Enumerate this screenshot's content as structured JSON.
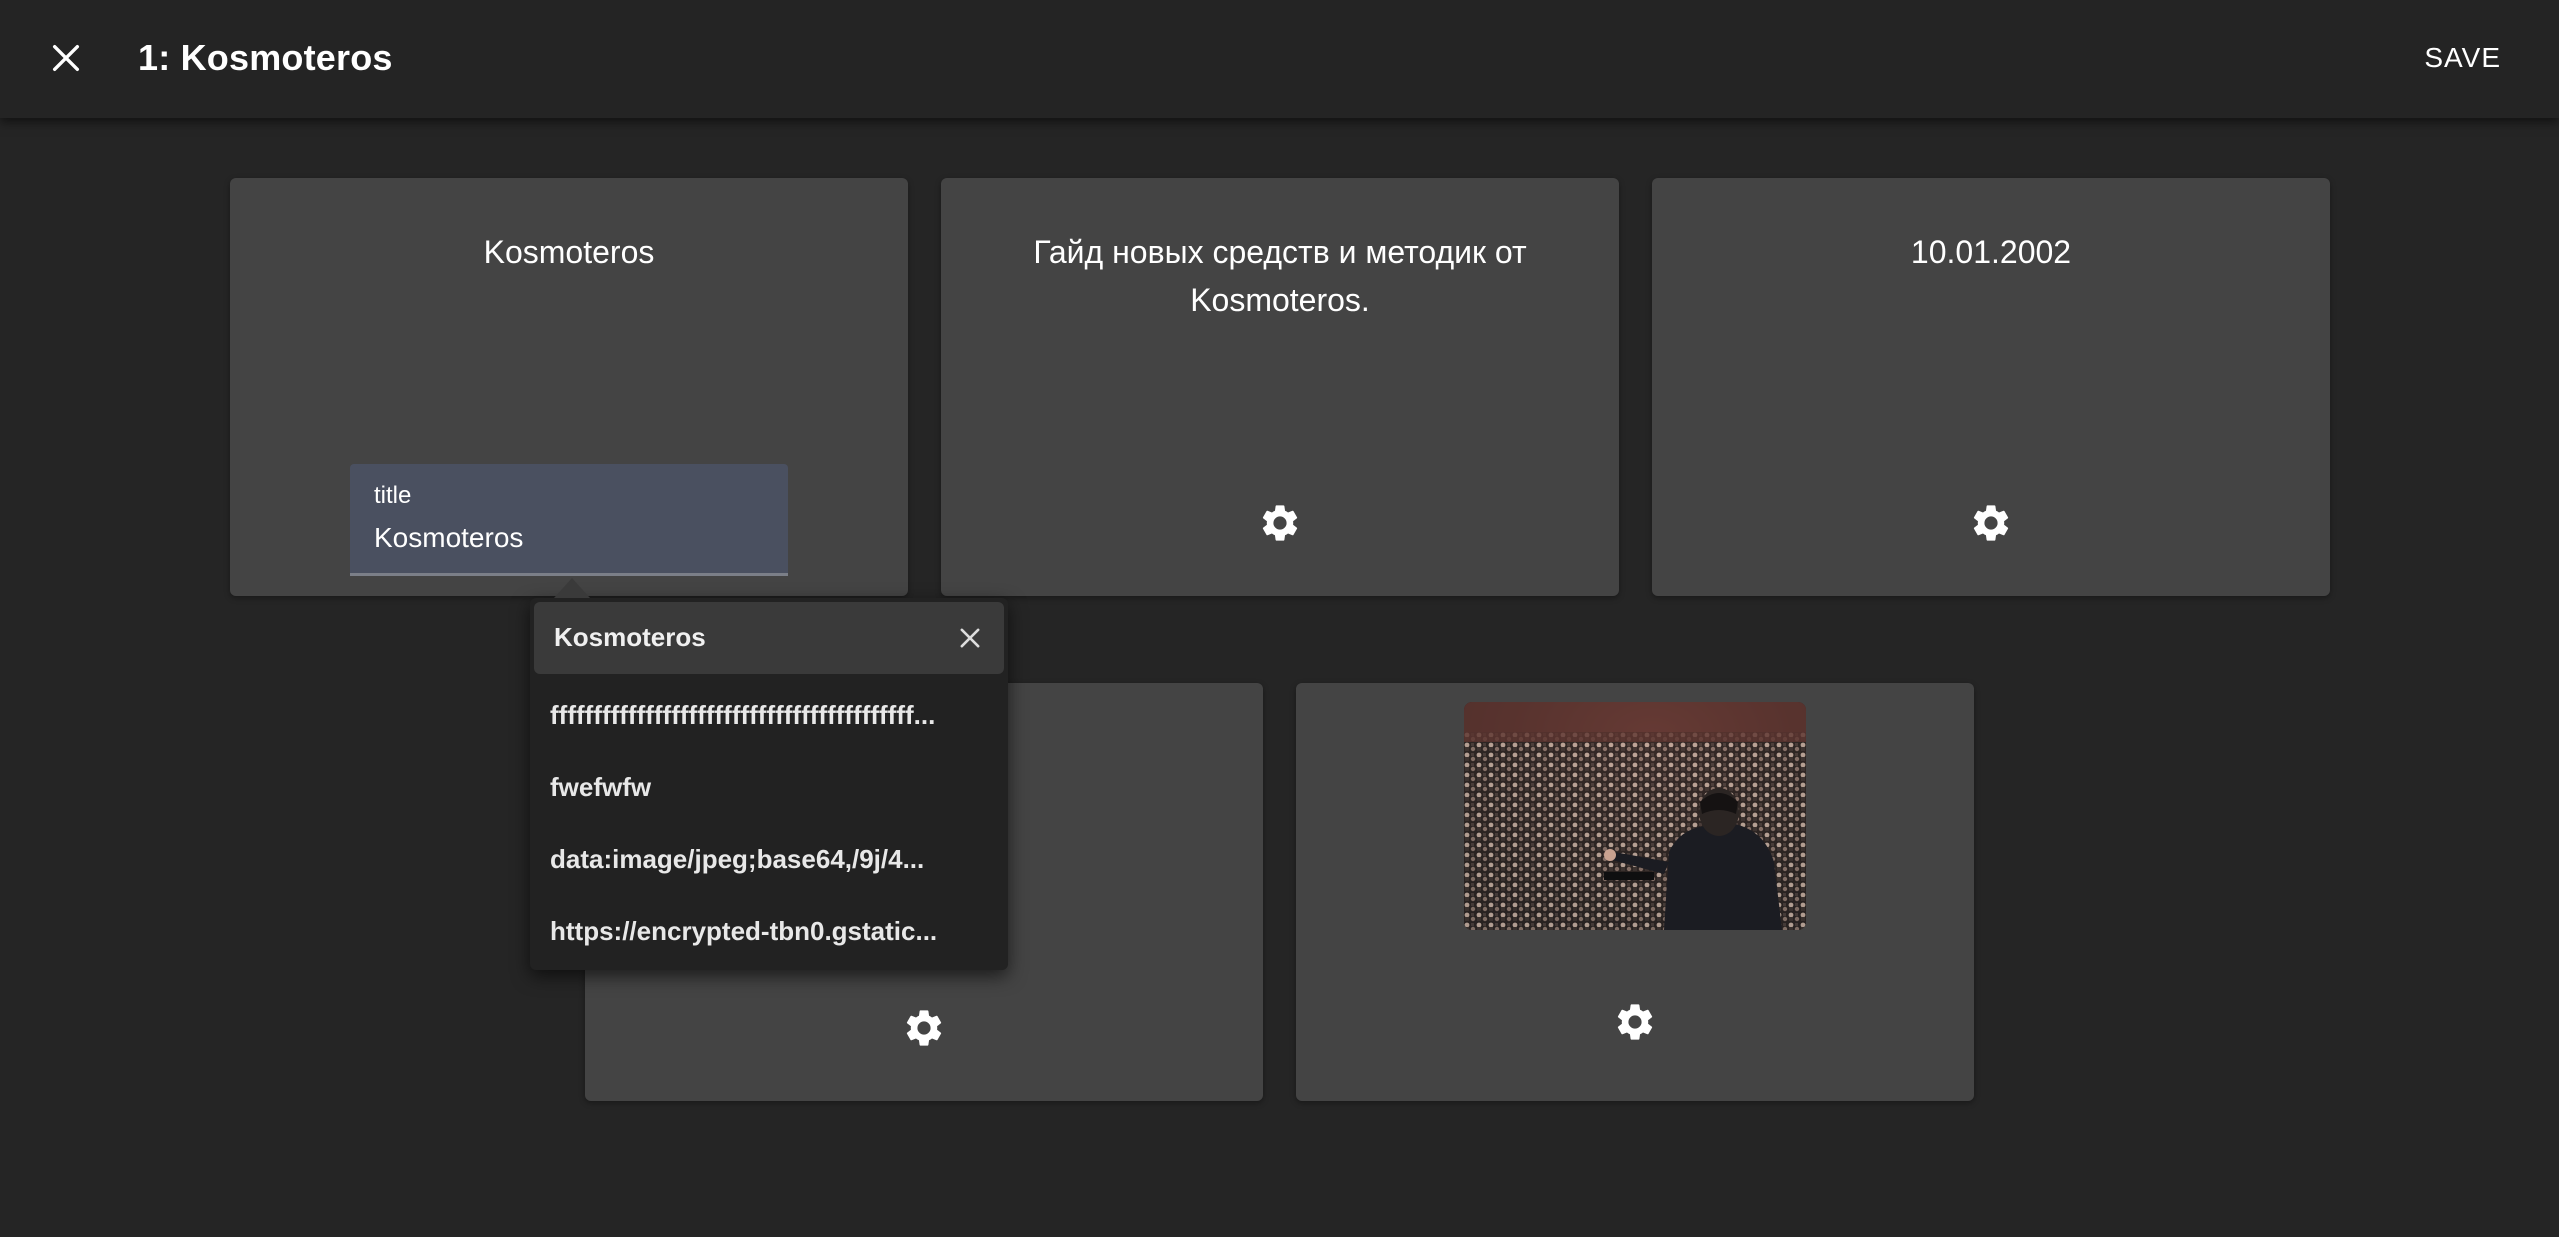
{
  "header": {
    "title": "1: Kosmoteros",
    "save_label": "SAVE"
  },
  "cards": [
    {
      "text": "Kosmoteros"
    },
    {
      "text": "Гайд новых средств и методик от Kosmoteros."
    },
    {
      "text": "10.01.2002"
    }
  ],
  "title_field": {
    "label": "title",
    "value": "Kosmoteros"
  },
  "dropdown": {
    "search_value": "Kosmoteros",
    "items": [
      "ffffffffffffffffffffffffffffffffffffffffff...",
      "fwefwfw",
      "data:image/jpeg;base64,/9j/4...",
      "https://encrypted-tbn0.gstatic..."
    ]
  },
  "icons": {
    "close": "close-icon",
    "settings": "gear-icon"
  },
  "colors": {
    "background": "#252525",
    "card": "#444444",
    "field": "#4a5060"
  }
}
